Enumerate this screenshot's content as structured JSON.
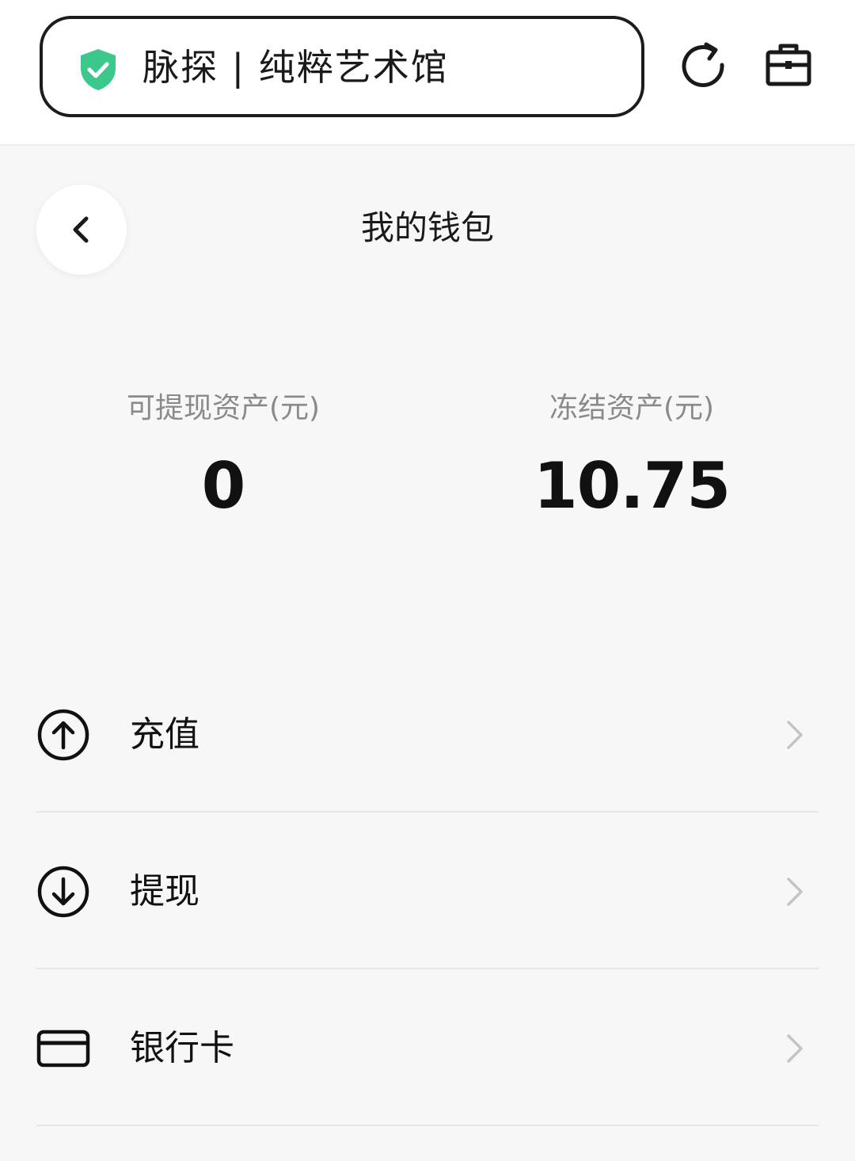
{
  "browser": {
    "site_title": "脉探 | 纯粹艺术馆",
    "secure_color": "#3cc88a"
  },
  "header": {
    "title": "我的钱包"
  },
  "assets": {
    "withdrawable_label": "可提现资产(元)",
    "withdrawable_value": "0",
    "frozen_label": "冻结资产(元)",
    "frozen_value": "10.75"
  },
  "menu": {
    "items": [
      {
        "label": "充值",
        "icon": "arrow-up-circle-icon"
      },
      {
        "label": "提现",
        "icon": "arrow-down-circle-icon"
      },
      {
        "label": "银行卡",
        "icon": "credit-card-icon"
      }
    ]
  }
}
